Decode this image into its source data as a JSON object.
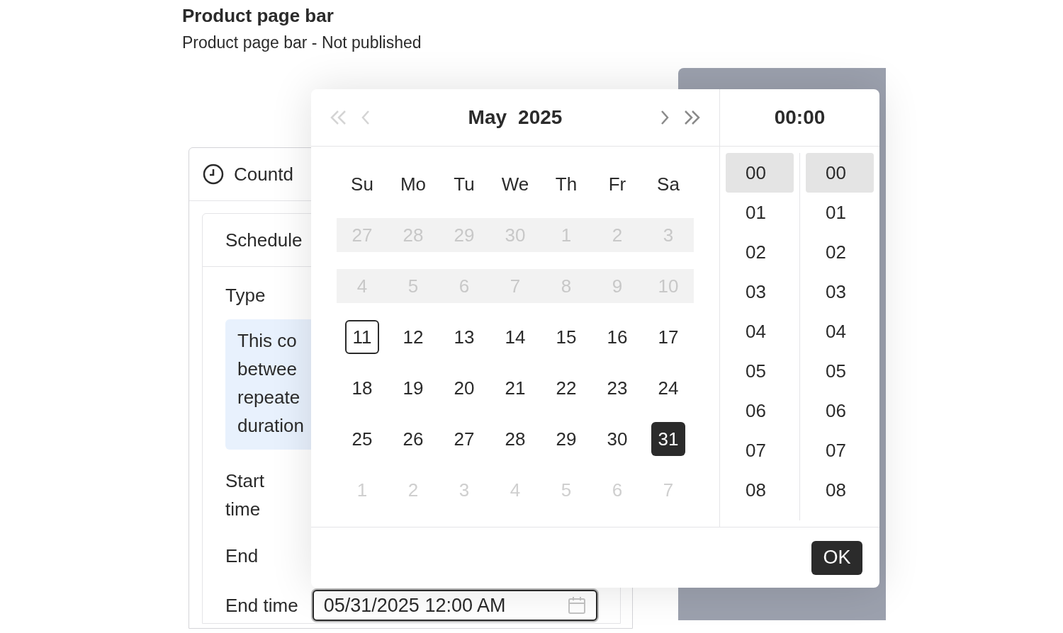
{
  "header": {
    "title": "Product page bar",
    "subtitle": "Product page bar - Not published"
  },
  "card": {
    "title": "Countd",
    "section": {
      "title": "Schedule",
      "type_label": "Type",
      "info": "This co betwee repeate duration",
      "start_label": "Start time",
      "end_label": "End",
      "end_time_label": "End time",
      "end_time_value": "05/31/2025 12:00 AM"
    }
  },
  "picker": {
    "month": "May",
    "year": "2025",
    "time": "00:00",
    "weekdays": [
      "Su",
      "Mo",
      "Tu",
      "We",
      "Th",
      "Fr",
      "Sa"
    ],
    "days": [
      {
        "label": "27",
        "kind": "disabled",
        "today": false,
        "selected": false
      },
      {
        "label": "28",
        "kind": "disabled",
        "today": false,
        "selected": false
      },
      {
        "label": "29",
        "kind": "disabled",
        "today": false,
        "selected": false
      },
      {
        "label": "30",
        "kind": "disabled",
        "today": false,
        "selected": false
      },
      {
        "label": "1",
        "kind": "disabled",
        "today": false,
        "selected": false
      },
      {
        "label": "2",
        "kind": "disabled",
        "today": false,
        "selected": false
      },
      {
        "label": "3",
        "kind": "disabled",
        "today": false,
        "selected": false
      },
      {
        "label": "4",
        "kind": "disabled",
        "today": false,
        "selected": false
      },
      {
        "label": "5",
        "kind": "disabled",
        "today": false,
        "selected": false
      },
      {
        "label": "6",
        "kind": "disabled",
        "today": false,
        "selected": false
      },
      {
        "label": "7",
        "kind": "disabled",
        "today": false,
        "selected": false
      },
      {
        "label": "8",
        "kind": "disabled",
        "today": false,
        "selected": false
      },
      {
        "label": "9",
        "kind": "disabled",
        "today": false,
        "selected": false
      },
      {
        "label": "10",
        "kind": "disabled",
        "today": false,
        "selected": false
      },
      {
        "label": "11",
        "kind": "current",
        "today": true,
        "selected": false
      },
      {
        "label": "12",
        "kind": "current",
        "today": false,
        "selected": false
      },
      {
        "label": "13",
        "kind": "current",
        "today": false,
        "selected": false
      },
      {
        "label": "14",
        "kind": "current",
        "today": false,
        "selected": false
      },
      {
        "label": "15",
        "kind": "current",
        "today": false,
        "selected": false
      },
      {
        "label": "16",
        "kind": "current",
        "today": false,
        "selected": false
      },
      {
        "label": "17",
        "kind": "current",
        "today": false,
        "selected": false
      },
      {
        "label": "18",
        "kind": "current",
        "today": false,
        "selected": false
      },
      {
        "label": "19",
        "kind": "current",
        "today": false,
        "selected": false
      },
      {
        "label": "20",
        "kind": "current",
        "today": false,
        "selected": false
      },
      {
        "label": "21",
        "kind": "current",
        "today": false,
        "selected": false
      },
      {
        "label": "22",
        "kind": "current",
        "today": false,
        "selected": false
      },
      {
        "label": "23",
        "kind": "current",
        "today": false,
        "selected": false
      },
      {
        "label": "24",
        "kind": "current",
        "today": false,
        "selected": false
      },
      {
        "label": "25",
        "kind": "current",
        "today": false,
        "selected": false
      },
      {
        "label": "26",
        "kind": "current",
        "today": false,
        "selected": false
      },
      {
        "label": "27",
        "kind": "current",
        "today": false,
        "selected": false
      },
      {
        "label": "28",
        "kind": "current",
        "today": false,
        "selected": false
      },
      {
        "label": "29",
        "kind": "current",
        "today": false,
        "selected": false
      },
      {
        "label": "30",
        "kind": "current",
        "today": false,
        "selected": false
      },
      {
        "label": "31",
        "kind": "current",
        "today": false,
        "selected": true
      },
      {
        "label": "1",
        "kind": "outside",
        "today": false,
        "selected": false
      },
      {
        "label": "2",
        "kind": "outside",
        "today": false,
        "selected": false
      },
      {
        "label": "3",
        "kind": "outside",
        "today": false,
        "selected": false
      },
      {
        "label": "4",
        "kind": "outside",
        "today": false,
        "selected": false
      },
      {
        "label": "5",
        "kind": "outside",
        "today": false,
        "selected": false
      },
      {
        "label": "6",
        "kind": "outside",
        "today": false,
        "selected": false
      },
      {
        "label": "7",
        "kind": "outside",
        "today": false,
        "selected": false
      }
    ],
    "hours": [
      {
        "label": "00",
        "selected": true
      },
      {
        "label": "01",
        "selected": false
      },
      {
        "label": "02",
        "selected": false
      },
      {
        "label": "03",
        "selected": false
      },
      {
        "label": "04",
        "selected": false
      },
      {
        "label": "05",
        "selected": false
      },
      {
        "label": "06",
        "selected": false
      },
      {
        "label": "07",
        "selected": false
      },
      {
        "label": "08",
        "selected": false
      }
    ],
    "minutes": [
      {
        "label": "00",
        "selected": true
      },
      {
        "label": "01",
        "selected": false
      },
      {
        "label": "02",
        "selected": false
      },
      {
        "label": "03",
        "selected": false
      },
      {
        "label": "04",
        "selected": false
      },
      {
        "label": "05",
        "selected": false
      },
      {
        "label": "06",
        "selected": false
      },
      {
        "label": "07",
        "selected": false
      },
      {
        "label": "08",
        "selected": false
      }
    ],
    "ok_button": "OK"
  }
}
